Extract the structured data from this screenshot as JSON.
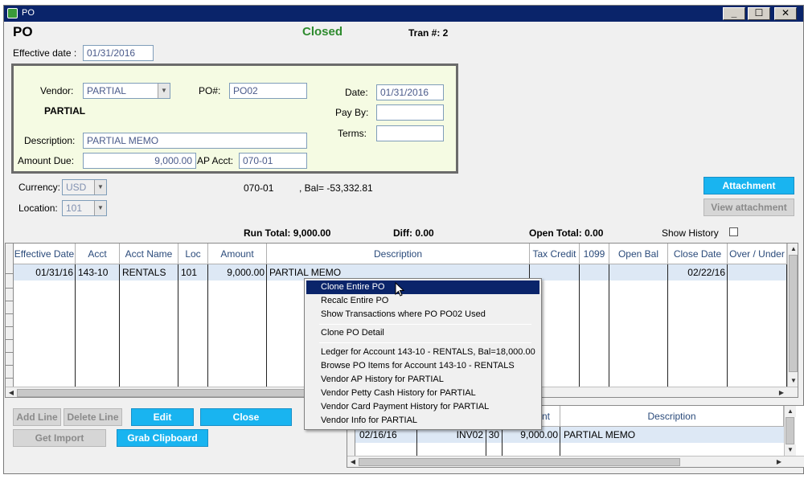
{
  "window": {
    "title": "PO",
    "minimize_label": "_",
    "maximize_label": "☐",
    "close_label": "✕"
  },
  "header": {
    "heading": "PO",
    "status": "Closed",
    "tran_label": "Tran #: 2",
    "effective_date_label": "Effective date :",
    "effective_date_value": "01/31/2016"
  },
  "vendor_panel": {
    "vendor_label": "Vendor:",
    "vendor_value": "PARTIAL",
    "vendor_name": "PARTIAL",
    "po_label": "PO#:",
    "po_value": "PO02",
    "date_label": "Date:",
    "date_value": "01/31/2016",
    "pay_by_label": "Pay By:",
    "pay_by_value": "",
    "terms_label": "Terms:",
    "terms_value": "",
    "description_label": "Description:",
    "description_value": "PARTIAL MEMO",
    "amount_due_label": "Amount Due:",
    "amount_due_value": "9,000.00",
    "ap_acct_label": "AP Acct:",
    "ap_acct_value": "070-01"
  },
  "misc": {
    "currency_label": "Currency:",
    "currency_value": "USD",
    "location_label": "Location:",
    "location_value": "101",
    "acct_code": "070-01",
    "balance_text": ",  Bal= -53,332.81",
    "attachment_label": "Attachment",
    "view_attachment_label": "View attachment"
  },
  "totals": {
    "run_total": "Run Total:  9,000.00",
    "diff": "Diff:   0.00",
    "open_total": "Open Total:   0.00",
    "show_history_label": "Show History"
  },
  "grid": {
    "columns": [
      "Effective Date",
      "Acct",
      "Acct Name",
      "Loc",
      "Amount",
      "Description",
      "Tax Credit",
      "1099",
      "Open Bal",
      "Close Date",
      "Over / Under"
    ],
    "row": {
      "effective_date": "01/31/16",
      "acct": "143-10",
      "acct_name": "RENTALS",
      "loc": "101",
      "amount": "9,000.00",
      "description": "PARTIAL MEMO",
      "close_date": "02/22/16"
    }
  },
  "buttons": {
    "add_line": "Add Line",
    "delete_line": "Delete Line",
    "edit": "Edit",
    "close": "Close",
    "get_import": "Get Import",
    "grab_clipboard": "Grab Clipboard"
  },
  "sub_grid": {
    "columns": [
      "nt",
      "Description"
    ],
    "row": {
      "date": "02/16/16",
      "invoice": "INV02",
      "qty": "30",
      "amount": "9,000.00",
      "description": "PARTIAL MEMO"
    }
  },
  "context_menu": {
    "items": [
      "Clone Entire PO",
      "Recalc Entire PO",
      "Show Transactions where PO PO02       Used",
      "Clone PO Detail",
      "Ledger for Account 143-10 - RENTALS,  Bal=18,000.00",
      "Browse PO Items for Account 143-10 - RENTALS",
      "Vendor AP History for PARTIAL",
      "Vendor Petty Cash History for PARTIAL",
      "Vendor Card Payment History for PARTIAL",
      "Vendor Info for PARTIAL"
    ]
  },
  "colors": {
    "titlebar": "#0a246a",
    "status_green": "#2e8b2e",
    "accent_blue": "#19b4f0",
    "vendor_panel_bg": "#f5fbe3",
    "selected_row": "#dde8f5"
  }
}
